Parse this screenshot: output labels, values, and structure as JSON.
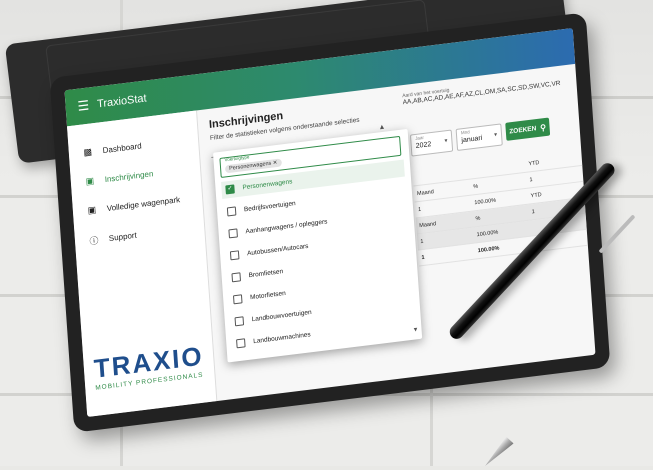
{
  "app": {
    "title": "TraxioStat"
  },
  "sidebar": {
    "items": [
      {
        "label": "Dashboard",
        "icon": "dashboard-icon"
      },
      {
        "label": "Inschrijvingen",
        "icon": "car-icon",
        "active": true
      },
      {
        "label": "Volledige wagenpark",
        "icon": "car-icon"
      },
      {
        "label": "Support",
        "icon": "help-icon"
      }
    ],
    "logo": {
      "brand": "TRAXIO",
      "tagline": "MOBILITY PROFESSIONALS"
    }
  },
  "main": {
    "title": "Inschrijvingen",
    "subtitle": "Filter de statistieken volgens onderstaande selecties",
    "codes_label": "Aard van het voertuig",
    "codes_value": "AA,AB,AC,AD,AE,AF,AZ,CL,OM,SA,SC,SD,SW,VC,VR",
    "year": {
      "label": "Jaar",
      "value": "2022"
    },
    "month": {
      "label": "Mnd",
      "value": "januari"
    },
    "search_label": "ZOEKEN"
  },
  "dropdown": {
    "field_label": "Voertuigtype",
    "chip": "Personenwagens",
    "options": [
      {
        "label": "Personenwagens",
        "checked": true
      },
      {
        "label": "Bedrijfsvoertuigen",
        "checked": false
      },
      {
        "label": "Aanhangwagens / opleggers",
        "checked": false
      },
      {
        "label": "Autobussen/Autocars",
        "checked": false
      },
      {
        "label": "Bromfietsen",
        "checked": false
      },
      {
        "label": "Motorfietsen",
        "checked": false
      },
      {
        "label": "Landbouwvoertuigen",
        "checked": false
      },
      {
        "label": "Landbouwmachines",
        "checked": false
      }
    ]
  },
  "table": {
    "rows": [
      [
        "",
        "",
        "YTD"
      ],
      [
        "Maand",
        "%",
        "1"
      ],
      [
        "1",
        "100.00%",
        "YTD"
      ],
      [
        "Maand",
        "%",
        "1"
      ],
      [
        "1",
        "100.00%",
        ""
      ],
      [
        "1",
        "100.00%",
        "1"
      ]
    ]
  },
  "colors": {
    "accent": "#2f8b48",
    "brand_blue": "#1f4e8c"
  }
}
